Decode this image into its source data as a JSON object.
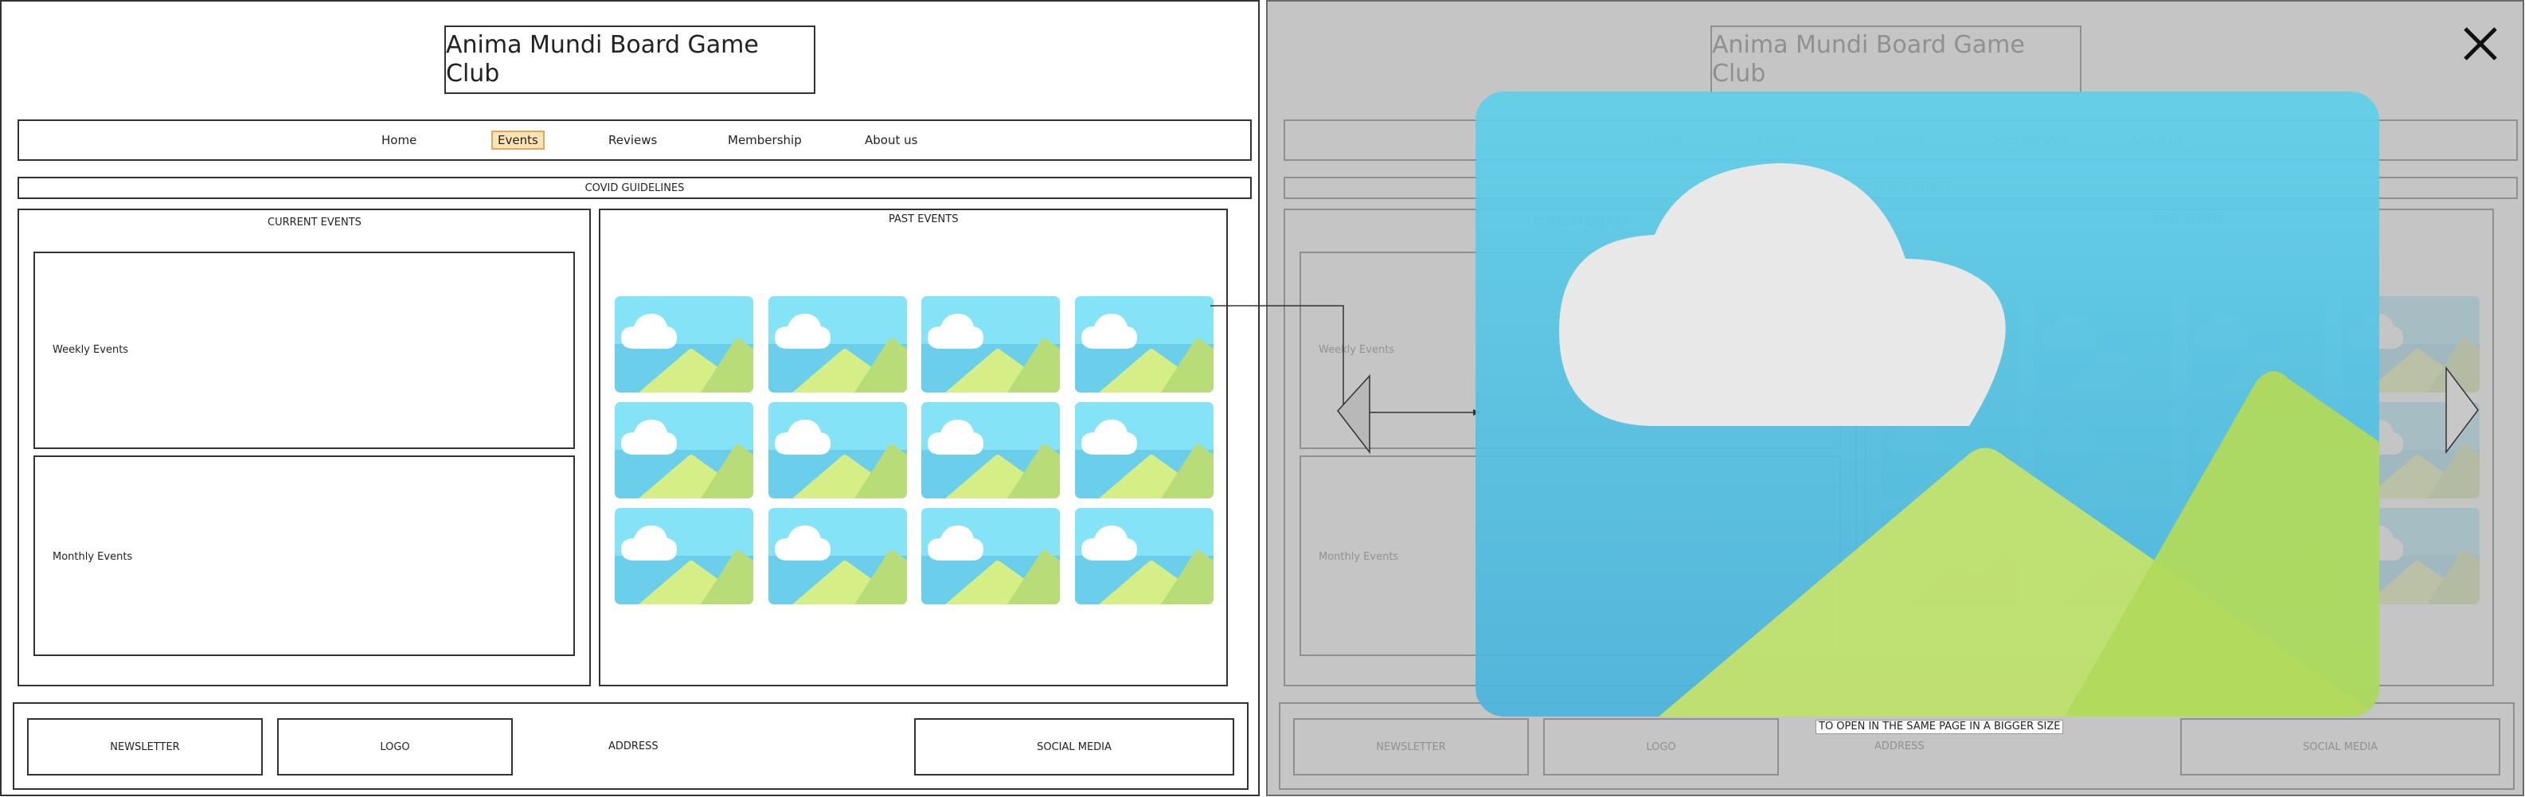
{
  "site": {
    "title": "Anima Mundi Board Game Club"
  },
  "nav": {
    "items": [
      {
        "label": "Home"
      },
      {
        "label": "Events"
      },
      {
        "label": "Reviews"
      },
      {
        "label": "Membership"
      },
      {
        "label": "About us"
      }
    ],
    "active": "Events"
  },
  "banner": {
    "label": "COVID GUIDELINES"
  },
  "current_events": {
    "heading": "CURRENT EVENTS",
    "weekly": "Weekly Events",
    "monthly": "Monthly Events"
  },
  "past_events": {
    "heading": "PAST EVENTS",
    "image_count": 12,
    "image_icon": "landscape-image-placeholder-icon"
  },
  "footer": {
    "newsletter": "NEWSLETTER",
    "logo": "LOGO",
    "address": "ADDRESS",
    "social": "SOCIAL MEDIA"
  },
  "lightbox": {
    "annotation": "TO OPEN IN THE SAME PAGE IN A BIGGER SIZE",
    "close_icon": "close-icon",
    "prev_icon": "triangle-left-icon",
    "next_icon": "triangle-right-icon"
  },
  "colors": {
    "sky_top": "#85e3f7",
    "sky_bottom": "#55bde0",
    "hill_light": "#d6ee86",
    "hill_dark": "#b7dc78",
    "cloud": "#ffffff",
    "nav_active_bg": "#fde3b4",
    "nav_active_border": "#e0a85c"
  }
}
